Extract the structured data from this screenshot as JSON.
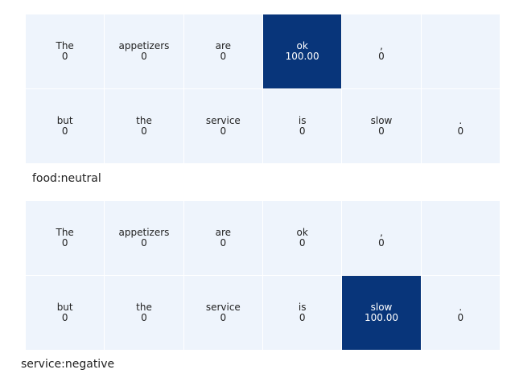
{
  "colors": {
    "low": "#eef4fc",
    "high": "#08357a",
    "text_dark": "#222222",
    "text_light": "#ffffff",
    "grid": "#ffffff"
  },
  "chart_data": [
    {
      "type": "heatmap",
      "title": "food:neutral",
      "rows": [
        [
          {
            "token": "The",
            "value": 0
          },
          {
            "token": "appetizers",
            "value": 0
          },
          {
            "token": "are",
            "value": 0
          },
          {
            "token": "ok",
            "value": 100.0,
            "label": "100.00"
          },
          {
            "token": ",",
            "value": 0
          },
          {
            "token": "",
            "value": null
          }
        ],
        [
          {
            "token": "but",
            "value": 0
          },
          {
            "token": "the",
            "value": 0
          },
          {
            "token": "service",
            "value": 0
          },
          {
            "token": "is",
            "value": 0
          },
          {
            "token": "slow",
            "value": 0
          },
          {
            "token": ".",
            "value": 0
          }
        ]
      ],
      "vmin": 0,
      "vmax": 100
    },
    {
      "type": "heatmap",
      "title": "service:negative",
      "rows": [
        [
          {
            "token": "The",
            "value": 0
          },
          {
            "token": "appetizers",
            "value": 0
          },
          {
            "token": "are",
            "value": 0
          },
          {
            "token": "ok",
            "value": 0
          },
          {
            "token": ",",
            "value": 0
          },
          {
            "token": "",
            "value": null
          }
        ],
        [
          {
            "token": "but",
            "value": 0
          },
          {
            "token": "the",
            "value": 0
          },
          {
            "token": "service",
            "value": 0
          },
          {
            "token": "is",
            "value": 0
          },
          {
            "token": "slow",
            "value": 100.0,
            "label": "100.00"
          },
          {
            "token": ".",
            "value": 0
          }
        ]
      ],
      "vmin": 0,
      "vmax": 100
    }
  ]
}
